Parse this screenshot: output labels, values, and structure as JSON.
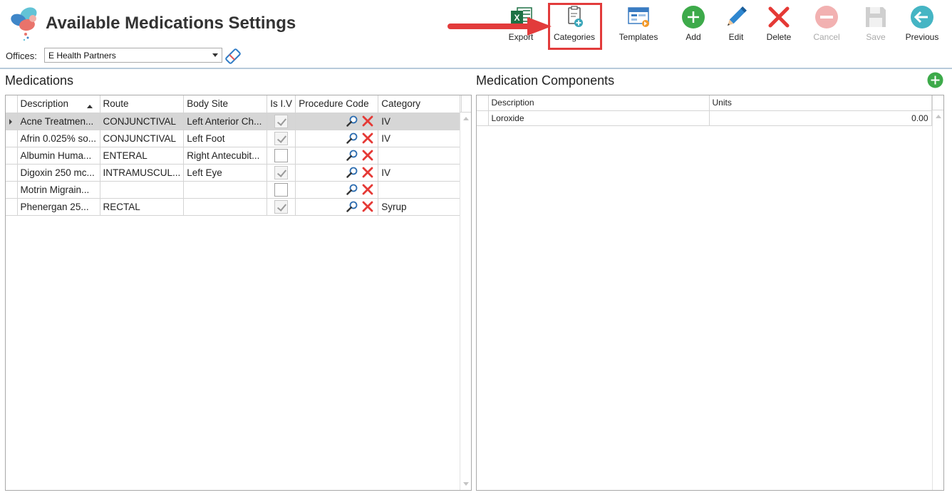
{
  "app": {
    "title": "Available Medications Settings"
  },
  "offices": {
    "label": "Offices:",
    "selected": "E Health Partners"
  },
  "toolbar": {
    "export": "Export",
    "categories": "Categories",
    "templates": "Templates",
    "add": "Add",
    "edit": "Edit",
    "delete": "Delete",
    "cancel": "Cancel",
    "save": "Save",
    "previous": "Previous"
  },
  "medications": {
    "title": "Medications",
    "columns": [
      "Description",
      "Route",
      "Body Site",
      "Is I.V",
      "Procedure Code",
      "Category"
    ],
    "rows": [
      {
        "description": "Acne Treatmen...",
        "route": "CONJUNCTIVAL",
        "body_site": "Left Anterior Ch...",
        "is_iv": true,
        "category": "IV",
        "selected": true
      },
      {
        "description": "Afrin 0.025% so...",
        "route": "CONJUNCTIVAL",
        "body_site": "Left Foot",
        "is_iv": true,
        "category": "IV",
        "selected": false
      },
      {
        "description": "Albumin Huma...",
        "route": "ENTERAL",
        "body_site": "Right Antecubit...",
        "is_iv": false,
        "category": "",
        "selected": false
      },
      {
        "description": "Digoxin 250 mc...",
        "route": "INTRAMUSCUL...",
        "body_site": "Left Eye",
        "is_iv": true,
        "category": "IV",
        "selected": false
      },
      {
        "description": "Motrin Migrain...",
        "route": "",
        "body_site": "",
        "is_iv": false,
        "category": "",
        "selected": false
      },
      {
        "description": "Phenergan 25...",
        "route": "RECTAL",
        "body_site": "",
        "is_iv": true,
        "category": "Syrup",
        "selected": false
      }
    ]
  },
  "components": {
    "title": "Medication Components",
    "columns": [
      "Description",
      "Units"
    ],
    "rows": [
      {
        "description": "Loroxide",
        "units": "0.00"
      }
    ]
  },
  "colors": {
    "accent_red": "#e23b3b",
    "add_green": "#3daa4a",
    "delete_red": "#e53935",
    "excel_green": "#1e7145",
    "previous_teal": "#45b5c4"
  }
}
